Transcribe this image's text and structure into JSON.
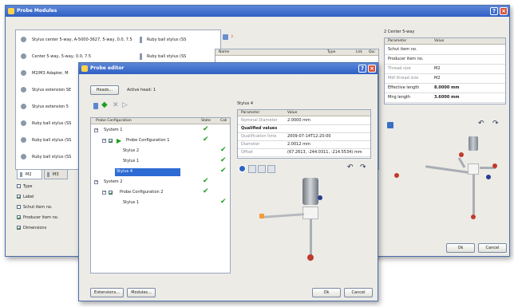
{
  "back_window": {
    "title": "Probe Modules",
    "list_items": [
      "Stylus center 5-way, A-5000-3627, 5-way, 0.0, 7.5",
      "Center 5-way, 5-way, 0.0, 7.5",
      "M2/M3 Adapter, M",
      "Stylus extension SE",
      "Stylus extension 5",
      "Ruby ball stylus (SS",
      "Ruby ball stylus (SS",
      "Ruby ball stylus (SS"
    ],
    "col_list_items": [
      "Ruby ball stylus (SS",
      "Ruby ball stylus (SS"
    ],
    "mid_table": {
      "headers": [
        "Name",
        "Type",
        "Lnk",
        "Qui"
      ]
    },
    "tabs": [
      "M2",
      "M3"
    ],
    "checkboxes": [
      {
        "label": "Type",
        "checked": false
      },
      {
        "label": "Label",
        "checked": true
      },
      {
        "label": "Schut item no.",
        "checked": false
      },
      {
        "label": "Producer item no.",
        "checked": true
      },
      {
        "label": "Dimensions",
        "checked": true
      }
    ],
    "right_panel": {
      "title": "2 Center 5-way",
      "headers": [
        "Parameter",
        "Value"
      ],
      "rows": [
        {
          "param": "Schut item no.",
          "value": ""
        },
        {
          "param": "Producer item no.",
          "value": ""
        },
        {
          "param": "Thread size",
          "value": "M2"
        },
        {
          "param": "Mdl thread size",
          "value": "M2"
        },
        {
          "param": "Effective length",
          "value": "8.0000 mm"
        },
        {
          "param": "Mng length",
          "value": "3.6000 mm"
        }
      ]
    },
    "ok_label": "Ok",
    "cancel_label": "Cancel"
  },
  "front_window": {
    "title": "Probe editor",
    "heads_button": "Heads...",
    "active_head_label": "Active head: 1",
    "tree_headers": [
      "Probe Configuration",
      "State",
      "Cali"
    ],
    "tree_rows": [
      {
        "label": "System 1",
        "indent": 0,
        "state": true,
        "cali": false,
        "selected": false
      },
      {
        "label": "Probe Configuration 1",
        "indent": 1,
        "state": true,
        "cali": false,
        "selected": false
      },
      {
        "label": "Stylus 2",
        "indent": 2,
        "state": false,
        "cali": true,
        "selected": false
      },
      {
        "label": "Stylus 1",
        "indent": 2,
        "state": false,
        "cali": true,
        "selected": false
      },
      {
        "label": "Stylus 4",
        "indent": 2,
        "state": false,
        "cali": true,
        "selected": true
      },
      {
        "label": "System 2",
        "indent": 0,
        "state": true,
        "cali": false,
        "selected": false
      },
      {
        "label": "Probe Configuration 2",
        "indent": 1,
        "state": true,
        "cali": false,
        "selected": false
      },
      {
        "label": "Stylus 1",
        "indent": 2,
        "state": false,
        "cali": true,
        "selected": false
      }
    ],
    "stylus_title": "Stylus 4",
    "param_headers": [
      "Parameter",
      "Value"
    ],
    "param_rows": [
      {
        "param": "Nominal Diameter",
        "value": "2.0000 mm",
        "bold": false
      },
      {
        "param": "Qualified values",
        "value": "",
        "bold": true
      },
      {
        "param": "Qualification time",
        "value": "2009-07-14T12:20:00",
        "bold": false
      },
      {
        "param": "Diameter",
        "value": "2.0012 mm",
        "bold": false
      },
      {
        "param": "Offset",
        "value": "(67.2613, -244.0311, -214.5534) mm",
        "bold": false
      }
    ],
    "extensions_button": "Extensions...",
    "modules_button": "Modules...",
    "ok_label": "Ok",
    "cancel_label": "Cancel"
  },
  "colors": {
    "title_bar": "#2f5fc4",
    "window_bg": "#ecebe6",
    "selection": "#2d6bd3",
    "check": "#1e9e1e",
    "ruby": "#c0392b",
    "highlight_orange": "#f39c34"
  },
  "icons": [
    "window-icon",
    "help-icon",
    "close-icon",
    "probe-icon",
    "check-icon",
    "rotate-left-icon",
    "rotate-right-icon",
    "new-icon",
    "forward-icon",
    "delete-icon",
    "view-icon"
  ]
}
